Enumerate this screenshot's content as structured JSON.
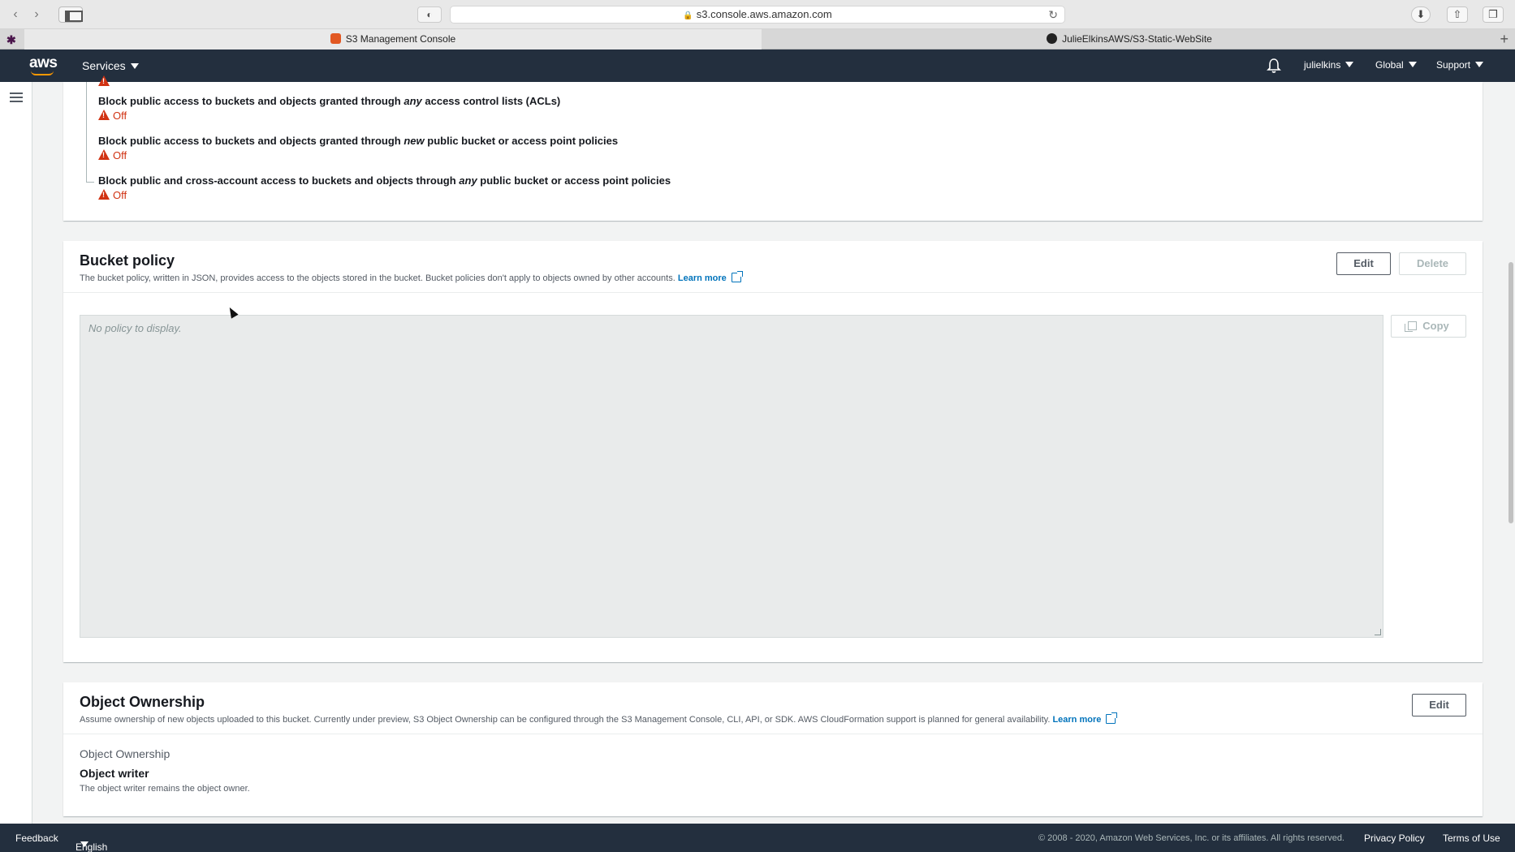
{
  "browser": {
    "url": "s3.console.aws.amazon.com",
    "tabs": [
      {
        "label": "S3 Management Console"
      },
      {
        "label": "JulieElkinsAWS/S3-Static-WebSite"
      }
    ]
  },
  "header": {
    "services_label": "Services",
    "user_label": "julielkins",
    "region_label": "Global",
    "support_label": "Support"
  },
  "block_public_access": {
    "items": [
      {
        "label_pre": "Block public access to buckets and objects granted through ",
        "label_em": "any",
        "label_post": " access control lists (ACLs)",
        "status": "Off"
      },
      {
        "label_pre": "Block public access to buckets and objects granted through ",
        "label_em": "new",
        "label_post": " public bucket or access point policies",
        "status": "Off"
      },
      {
        "label_pre": "Block public and cross-account access to buckets and objects through ",
        "label_em": "any",
        "label_post": " public bucket or access point policies",
        "status": "Off"
      }
    ]
  },
  "bucket_policy": {
    "title": "Bucket policy",
    "description": "The bucket policy, written in JSON, provides access to the objects stored in the bucket. Bucket policies don't apply to objects owned by other accounts.",
    "learn_more": "Learn more",
    "edit_label": "Edit",
    "delete_label": "Delete",
    "placeholder": "No policy to display.",
    "copy_label": "Copy"
  },
  "object_ownership": {
    "title": "Object Ownership",
    "description": "Assume ownership of new objects uploaded to this bucket. Currently under preview, S3 Object Ownership can be configured through the S3 Management Console, CLI, API, or SDK. AWS CloudFormation support is planned for general availability.",
    "learn_more": "Learn more",
    "edit_label": "Edit",
    "field_label": "Object Ownership",
    "field_value": "Object writer",
    "field_description": "The object writer remains the object owner."
  },
  "footer": {
    "feedback_label": "Feedback",
    "language_label": "English (US)",
    "copyright": "© 2008 - 2020, Amazon Web Services, Inc. or its affiliates. All rights reserved.",
    "privacy_label": "Privacy Policy",
    "terms_label": "Terms of Use"
  },
  "colors": {
    "aws_nav": "#232f3e",
    "aws_orange": "#ff9900",
    "link": "#0073bb",
    "warning": "#d13212"
  }
}
